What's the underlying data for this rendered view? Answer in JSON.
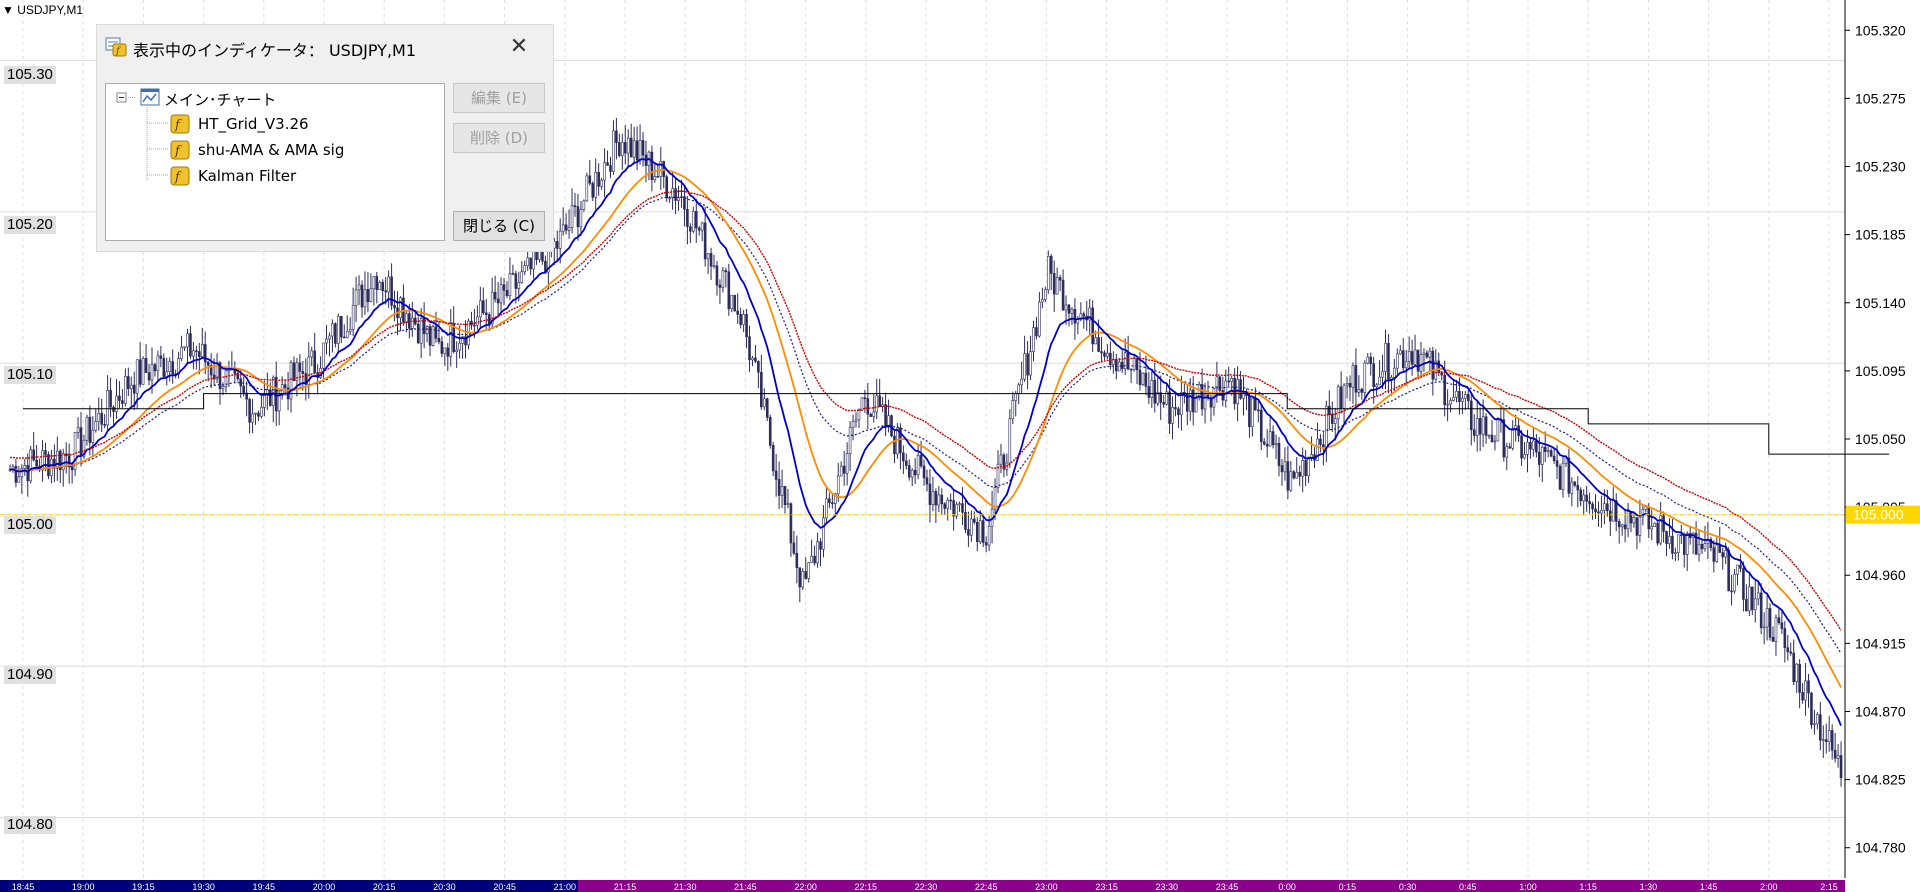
{
  "symbol_label": "▼ USDJPY,M1",
  "left_grid_labels": [
    "105.30",
    "105.20",
    "105.10",
    "105.00",
    "104.90",
    "104.80"
  ],
  "price_axis": {
    "ticks": [
      "105.320",
      "105.275",
      "105.230",
      "105.185",
      "105.140",
      "105.095",
      "105.050",
      "105.005",
      "104.960",
      "104.915",
      "104.870",
      "104.825",
      "104.780"
    ],
    "current_price": "105.000",
    "current_price_color": "#ffd700"
  },
  "time_axis": {
    "labels": [
      "18:45",
      "19:00",
      "19:15",
      "19:30",
      "19:45",
      "20:00",
      "20:15",
      "20:30",
      "20:45",
      "21:00",
      "21:15",
      "21:30",
      "21:45",
      "22:00",
      "22:15",
      "22:30",
      "22:45",
      "23:00",
      "23:15",
      "23:30",
      "23:45",
      "0:00",
      "0:15",
      "0:30",
      "0:45",
      "1:00",
      "1:15",
      "1:30",
      "1:45",
      "2:00",
      "2:15"
    ],
    "bar_color_1": "#00007a",
    "bar_color_2": "#8b008b"
  },
  "dialog": {
    "title": "表示中のインディケータ： USDJPY,M1",
    "close_glyph": "✕",
    "tree_root": "メイン･チャート",
    "indicators": [
      "HT_Grid_V3.26",
      "shu-AMA & AMA sig",
      "Kalman Filter"
    ],
    "buttons": {
      "edit": "編集 (E)",
      "delete": "削除 (D)",
      "close": "閉じる (C)"
    }
  },
  "chart_data": {
    "type": "candlestick",
    "symbol": "USDJPY",
    "timeframe": "M1",
    "ylim": [
      104.76,
      105.34
    ],
    "x": [
      "18:45",
      "19:00",
      "19:15",
      "19:30",
      "19:45",
      "20:00",
      "20:15",
      "20:30",
      "20:45",
      "21:00",
      "21:15",
      "21:30",
      "21:45",
      "22:00",
      "22:15",
      "22:30",
      "22:45",
      "23:00",
      "23:15",
      "23:30",
      "23:45",
      "0:00",
      "0:15",
      "0:30",
      "0:45",
      "1:00",
      "1:15",
      "1:30",
      "1:45",
      "2:00",
      "2:15"
    ],
    "close": [
      105.03,
      105.04,
      105.09,
      105.11,
      105.07,
      105.1,
      105.16,
      105.11,
      105.14,
      105.18,
      105.25,
      105.21,
      105.13,
      104.95,
      105.08,
      105.02,
      104.99,
      105.16,
      105.11,
      105.07,
      105.09,
      105.02,
      105.09,
      105.11,
      105.06,
      105.04,
      105.01,
      104.99,
      104.97,
      104.92,
      104.83
    ],
    "high_line": [
      105.07,
      105.07,
      105.07,
      105.08,
      105.08,
      105.08,
      105.08,
      105.08,
      105.08,
      105.08,
      105.08,
      105.08,
      105.08,
      105.08,
      105.08,
      105.08,
      105.08,
      105.08,
      105.08,
      105.08,
      105.08,
      105.07,
      105.07,
      105.07,
      105.07,
      105.07,
      105.06,
      105.06,
      105.06,
      105.04,
      105.04
    ],
    "line_colors": {
      "candles": "#2c2c5a",
      "blue_ama": "#0000cc",
      "orange_ama": "#ff8c00",
      "red_signal": "#cc0000",
      "black_kalman": "#000000",
      "grid_dash": "#dddddd"
    }
  }
}
